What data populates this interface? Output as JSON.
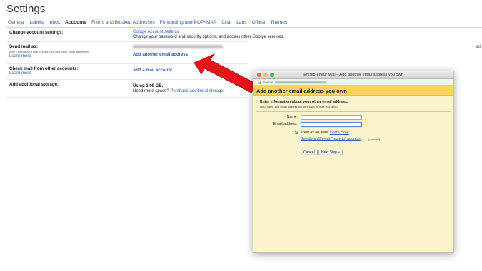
{
  "header": {
    "title": "Settings"
  },
  "tabs": [
    {
      "label": "General",
      "active": false
    },
    {
      "label": "Labels",
      "active": false
    },
    {
      "label": "Inbox",
      "active": false
    },
    {
      "label": "Accounts",
      "active": true
    },
    {
      "label": "Filters and Blocked Addresses",
      "active": false
    },
    {
      "label": "Forwarding and POP/IMAP",
      "active": false
    },
    {
      "label": "Chat",
      "active": false
    },
    {
      "label": "Labs",
      "active": false
    },
    {
      "label": "Offline",
      "active": false
    },
    {
      "label": "Themes",
      "active": false
    }
  ],
  "rows": {
    "change_account": {
      "label": "Change account settings:",
      "link": "Google Account settings",
      "desc": "Change your password and security options, and access other Google services."
    },
    "send_mail": {
      "label": "Send mail as:",
      "note": "(Use Entrepreneur Mail to send from your other email addresses)",
      "learn_more": "Learn more",
      "add_link": "Add another email address",
      "edit": "ed"
    },
    "check_mail": {
      "label": "Check mail from other accounts:",
      "learn_more": "Learn more",
      "add_link": "Add a mail account"
    },
    "storage": {
      "label": "Add additional storage:",
      "usage": "Using 1.09 GB.",
      "need_more": "Need more space?",
      "purchase": "Purchase additional storage"
    }
  },
  "dialog": {
    "window_title": "Entrepreneur Mail – Add another email address you own",
    "secure_label": "Secure",
    "header": "Add another email address you own",
    "instructions": "Enter information about your other email address.",
    "sub_instructions": "(your name and email address will be shown on mail you send)",
    "name_label": "Name:",
    "email_label": "Email address:",
    "alias_text": "Treat as an alias.",
    "alias_learn_more": "Learn more",
    "reply_to": "Specify a different \"reply-to\" address",
    "optional": "(optional)",
    "cancel": "Cancel",
    "next": "Next Step »"
  },
  "colors": {
    "link": "#2a5db0",
    "dialog_bg": "#fbf3cc",
    "dialog_header": "#f7d35f",
    "arrow": "#e8141b"
  },
  "icons": {
    "arrow": "red-arrow-icon",
    "checkbox": "checkbox-checked-icon"
  }
}
